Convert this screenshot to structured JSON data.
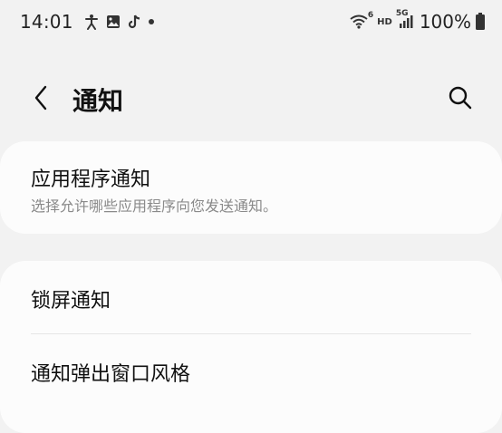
{
  "status_bar": {
    "time": "14:01",
    "hd_label": "HD",
    "network_label": "5G",
    "wifi_sub_label": "6",
    "battery_percent": "100%",
    "icons": [
      "accessibility-icon",
      "gallery-icon",
      "tiktok-icon",
      "dot-icon",
      "wifi-icon",
      "signal-icon",
      "battery-icon"
    ]
  },
  "header": {
    "title": "通知"
  },
  "settings": {
    "app_notifications": {
      "title": "应用程序通知",
      "subtitle": "选择允许哪些应用程序向您发送通知。"
    },
    "lock_screen_notifications": {
      "title": "锁屏通知"
    },
    "popup_style": {
      "title": "通知弹出窗口风格"
    }
  },
  "colors": {
    "background": "#f2f2f2",
    "card": "#fcfcfc",
    "subtitle": "#8a8a8a"
  }
}
